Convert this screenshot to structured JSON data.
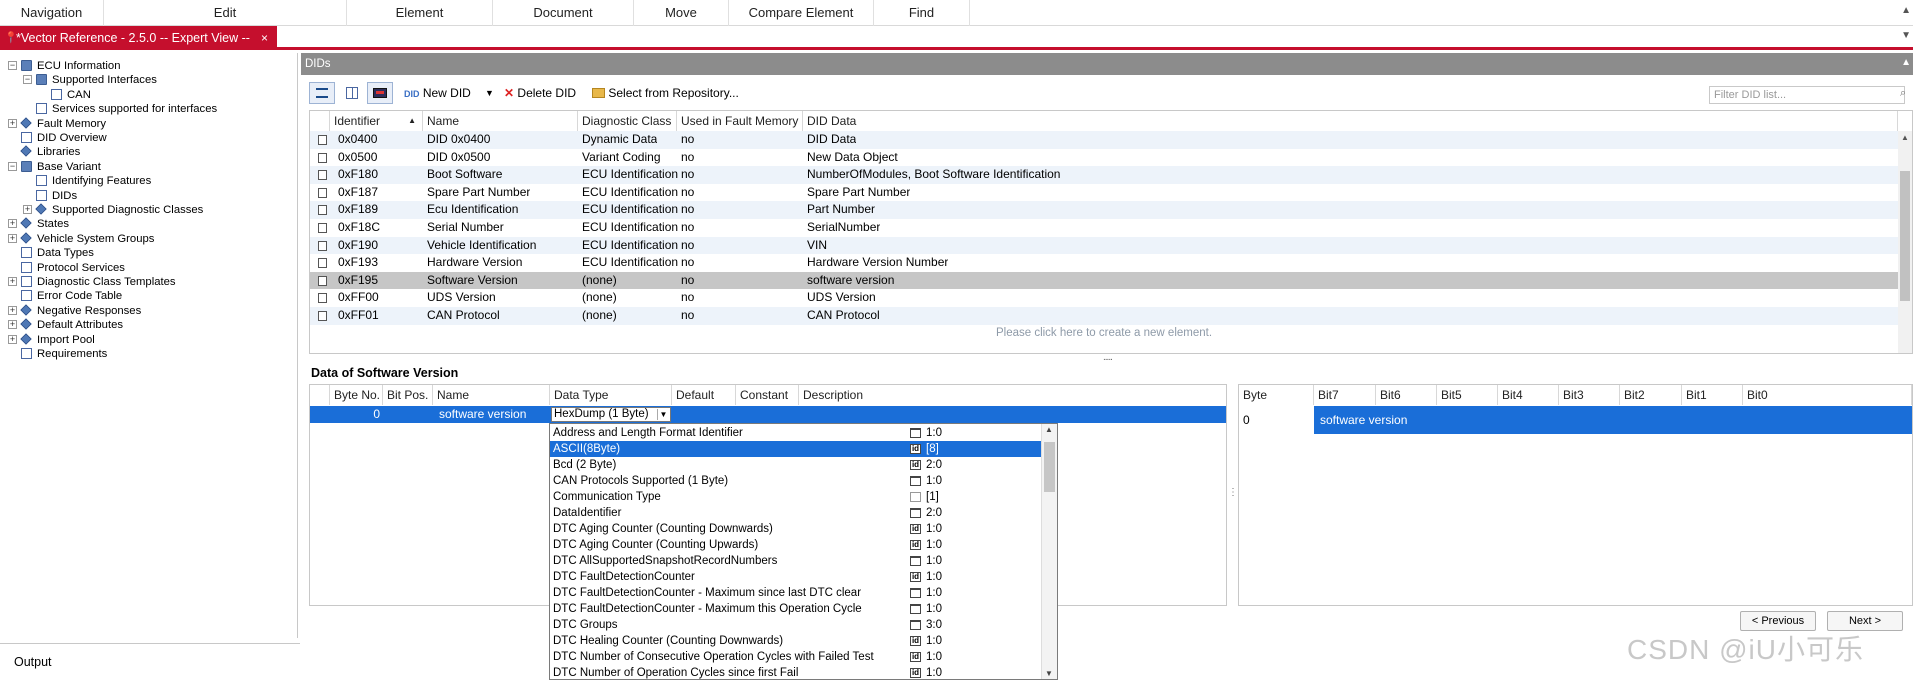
{
  "menu": [
    "Navigation",
    "Edit",
    "Element",
    "Document",
    "Move",
    "Compare Element",
    "Find"
  ],
  "tab": {
    "title": "*Vector Reference - 2.5.0 -- Expert View --",
    "close": "×"
  },
  "tree": [
    {
      "label": "ECU Information",
      "level": 0,
      "exp": "−",
      "icon": "folder"
    },
    {
      "label": "Supported Interfaces",
      "level": 1,
      "exp": "−",
      "icon": "folder"
    },
    {
      "label": "CAN",
      "level": 2,
      "exp": "",
      "icon": "page"
    },
    {
      "label": "Services supported for interfaces",
      "level": 1,
      "exp": "",
      "icon": "page"
    },
    {
      "label": "Fault Memory",
      "level": 0,
      "exp": "+",
      "icon": "diamond"
    },
    {
      "label": "DID Overview",
      "level": 0,
      "exp": "",
      "icon": "page"
    },
    {
      "label": "Libraries",
      "level": 0,
      "exp": "",
      "icon": "diamond"
    },
    {
      "label": "Base Variant",
      "level": 0,
      "exp": "−",
      "icon": "folder"
    },
    {
      "label": "Identifying Features",
      "level": 1,
      "exp": "",
      "icon": "page"
    },
    {
      "label": "DIDs",
      "level": 1,
      "exp": "",
      "icon": "page"
    },
    {
      "label": "Supported Diagnostic Classes",
      "level": 1,
      "exp": "+",
      "icon": "diamond"
    },
    {
      "label": "States",
      "level": 0,
      "exp": "+",
      "icon": "diamond"
    },
    {
      "label": "Vehicle System Groups",
      "level": 0,
      "exp": "+",
      "icon": "diamond"
    },
    {
      "label": "Data Types",
      "level": 0,
      "exp": "",
      "icon": "page"
    },
    {
      "label": "Protocol Services",
      "level": 0,
      "exp": "",
      "icon": "page"
    },
    {
      "label": "Diagnostic Class Templates",
      "level": 0,
      "exp": "+",
      "icon": "page"
    },
    {
      "label": "Error Code Table",
      "level": 0,
      "exp": "",
      "icon": "page"
    },
    {
      "label": "Negative Responses",
      "level": 0,
      "exp": "+",
      "icon": "diamond"
    },
    {
      "label": "Default Attributes",
      "level": 0,
      "exp": "+",
      "icon": "diamond"
    },
    {
      "label": "Import Pool",
      "level": 0,
      "exp": "+",
      "icon": "diamond"
    },
    {
      "label": "Requirements",
      "level": 0,
      "exp": "",
      "icon": "page"
    }
  ],
  "main": {
    "header": "DIDs",
    "toolbar": {
      "new_did": "New DID",
      "delete_did": "Delete DID",
      "select_repo": "Select from Repository...",
      "filter_placeholder": "Filter DID list..."
    },
    "columns": [
      "Identifier",
      "Name",
      "Diagnostic Class",
      "Used in Fault Memory",
      "DID Data"
    ],
    "rows": [
      [
        "0x0400",
        "DID 0x0400",
        "Dynamic Data",
        "no",
        "DID Data"
      ],
      [
        "0x0500",
        "DID 0x0500",
        "Variant Coding",
        "no",
        "New Data Object"
      ],
      [
        "0xF180",
        "Boot Software",
        "ECU Identification",
        "no",
        "NumberOfModules, Boot Software Identification"
      ],
      [
        "0xF187",
        "Spare Part Number",
        "ECU Identification",
        "no",
        "Spare Part Number"
      ],
      [
        "0xF189",
        "Ecu Identification",
        "ECU Identification",
        "no",
        "Part Number"
      ],
      [
        "0xF18C",
        "Serial Number",
        "ECU Identification",
        "no",
        "SerialNumber"
      ],
      [
        "0xF190",
        "Vehicle Identification",
        "ECU Identification",
        "no",
        "VIN"
      ],
      [
        "0xF193",
        "Hardware Version",
        "ECU Identification",
        "no",
        "Hardware Version Number"
      ],
      [
        "0xF195",
        "Software Version",
        "(none)",
        "no",
        "software version"
      ],
      [
        "0xFF00",
        "UDS Version",
        "(none)",
        "no",
        "UDS Version"
      ],
      [
        "0xFF01",
        "CAN Protocol",
        "(none)",
        "no",
        "CAN Protocol"
      ]
    ],
    "selected_row": 8,
    "new_hint": "Please click here to create a new element.",
    "splitter": "....."
  },
  "data": {
    "title": "Data of Software Version",
    "columns": [
      "Byte No.",
      "Bit Pos.",
      "Name",
      "Data Type",
      "Default",
      "Constant",
      "Description"
    ],
    "row": {
      "byte": "0",
      "name": "software version",
      "type": "HexDump (1 Byte)"
    },
    "byte_columns": [
      "Byte",
      "Bit7",
      "Bit6",
      "Bit5",
      "Bit4",
      "Bit3",
      "Bit2",
      "Bit1",
      "Bit0"
    ],
    "byte_row": {
      "byte": "0",
      "label": "software version"
    },
    "dropdown": [
      {
        "label": "Address and Length Format Identifier",
        "icon": "table",
        "val": "1:0"
      },
      {
        "label": "ASCII(8Byte)",
        "icon": "id",
        "val": "[8]"
      },
      {
        "label": "Bcd (2 Byte)",
        "icon": "id",
        "val": "2:0"
      },
      {
        "label": "CAN Protocols Supported (1 Byte)",
        "icon": "table",
        "val": "1:0"
      },
      {
        "label": "Communication Type",
        "icon": "blank",
        "val": "[1]"
      },
      {
        "label": "DataIdentifier",
        "icon": "table",
        "val": "2:0"
      },
      {
        "label": "DTC Aging Counter (Counting Downwards)",
        "icon": "id",
        "val": "1:0"
      },
      {
        "label": "DTC Aging Counter (Counting Upwards)",
        "icon": "id",
        "val": "1:0"
      },
      {
        "label": "DTC AllSupportedSnapshotRecordNumbers",
        "icon": "table",
        "val": "1:0"
      },
      {
        "label": "DTC FaultDetectionCounter",
        "icon": "id",
        "val": "1:0"
      },
      {
        "label": "DTC FaultDetectionCounter - Maximum since last DTC clear",
        "icon": "table",
        "val": "1:0"
      },
      {
        "label": "DTC FaultDetectionCounter - Maximum this Operation Cycle",
        "icon": "table",
        "val": "1:0"
      },
      {
        "label": "DTC Groups",
        "icon": "table",
        "val": "3:0"
      },
      {
        "label": "DTC Healing Counter (Counting Downwards)",
        "icon": "id",
        "val": "1:0"
      },
      {
        "label": "DTC Number of Consecutive Operation Cycles with Failed Test",
        "icon": "id",
        "val": "1:0"
      },
      {
        "label": "DTC Number of Operation Cycles since first Fail",
        "icon": "id",
        "val": "1:0"
      }
    ],
    "highlighted": 1,
    "prev": "< Previous",
    "next": "Next >"
  },
  "output": "Output",
  "watermark": "CSDN @iU小可乐"
}
